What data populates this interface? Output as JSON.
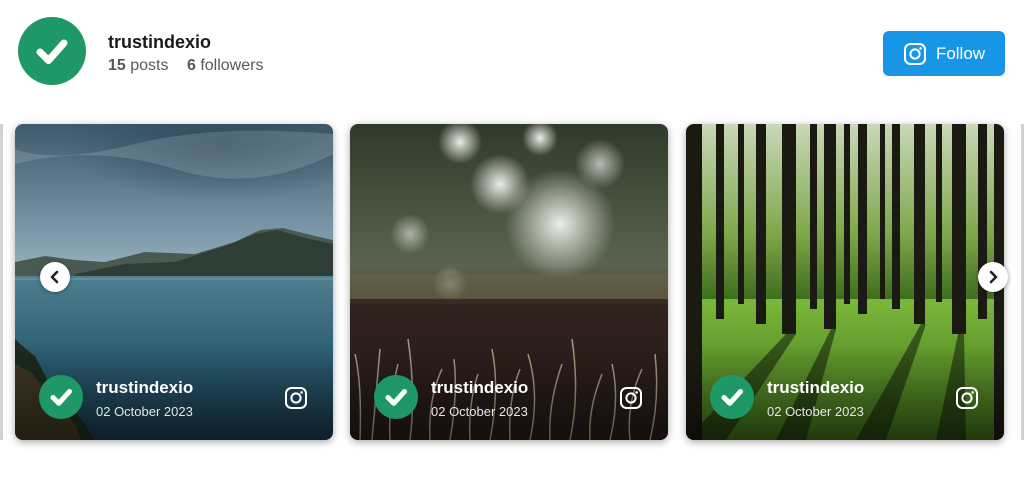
{
  "profile": {
    "username": "trustindexio",
    "posts_count": "15",
    "posts_label": "posts",
    "followers_count": "6",
    "followers_label": "followers",
    "follow_label": "Follow",
    "avatar_icon": "checkmark-icon",
    "follow_icon": "instagram-icon"
  },
  "colors": {
    "brand_green": "#1f9868",
    "follow_blue": "#1796e8"
  },
  "posts": [
    {
      "username": "trustindexio",
      "date": "02 October 2023",
      "image": "lake-mountain-photo"
    },
    {
      "username": "trustindexio",
      "date": "02 October 2023",
      "image": "blurred-grass-photo"
    },
    {
      "username": "trustindexio",
      "date": "02 October 2023",
      "image": "sunlit-forest-photo"
    }
  ],
  "navigation": {
    "prev_icon": "chevron-left-icon",
    "next_icon": "chevron-right-icon"
  }
}
